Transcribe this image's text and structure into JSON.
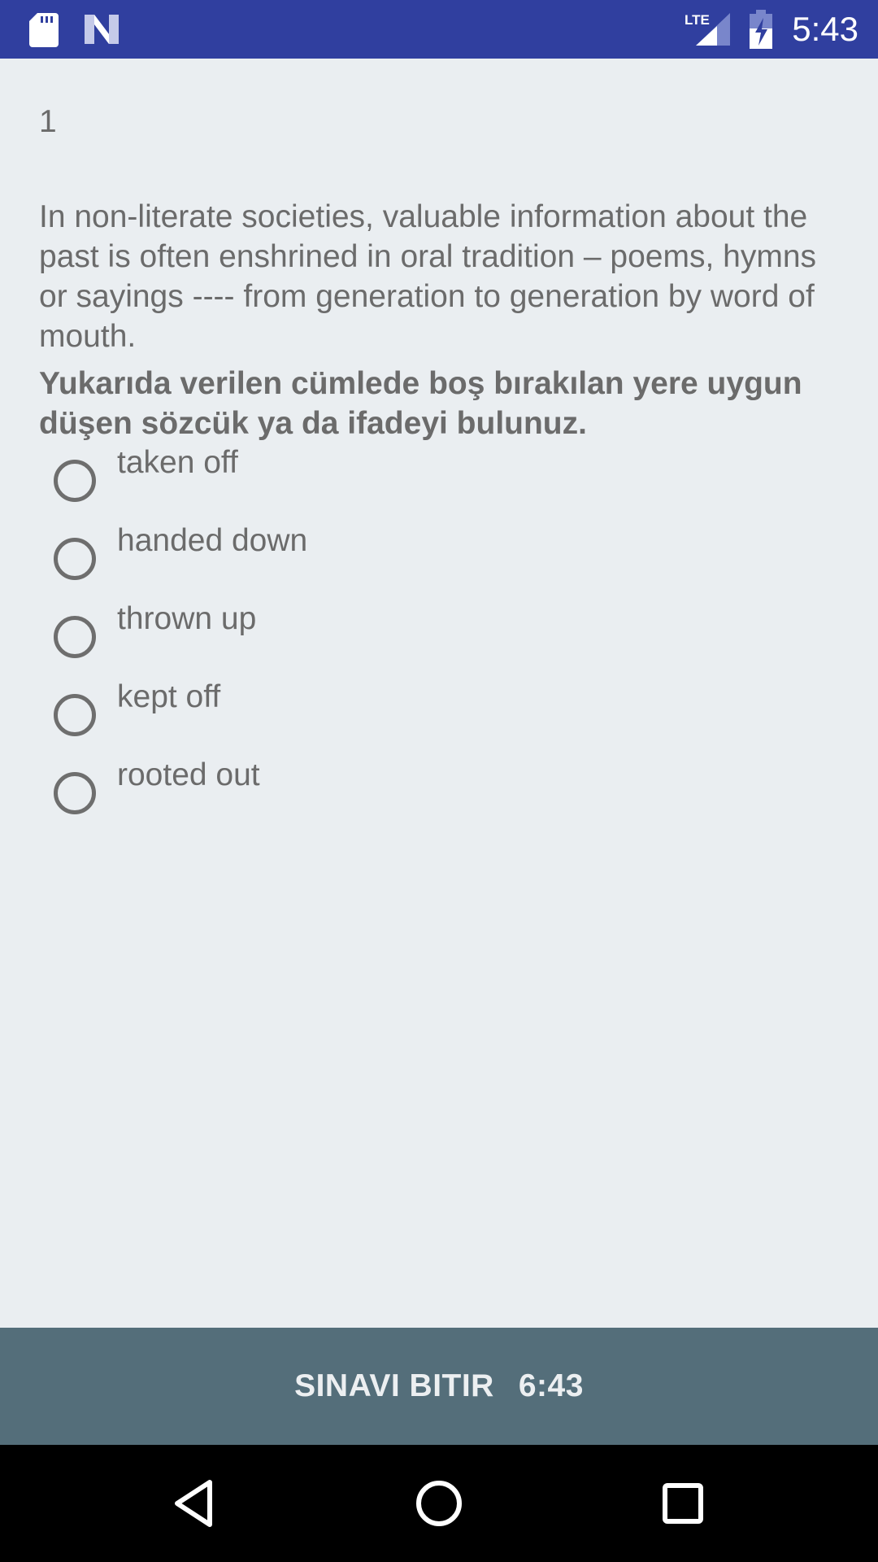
{
  "status_bar": {
    "time": "5:43",
    "icons": [
      "sd-card-icon",
      "n-logo-icon",
      "lte-signal-icon",
      "battery-charging-icon"
    ],
    "background": "#303f9f"
  },
  "question": {
    "number": "1",
    "text": "In non-literate societies, valuable information about the past is often enshrined in oral tradition – poems, hymns or sayings ---- from generation to generation by word of mouth.",
    "instruction": "Yukarıda verilen cümlede boş bırakılan yere uygun düşen sözcük ya da ifadeyi bulunuz."
  },
  "options": [
    {
      "label": "taken off",
      "selected": false
    },
    {
      "label": "handed down",
      "selected": false
    },
    {
      "label": "thrown up",
      "selected": false
    },
    {
      "label": "kept off",
      "selected": false
    },
    {
      "label": "rooted out",
      "selected": false
    }
  ],
  "finish_bar": {
    "label": "SINAVI BITIR",
    "timer": "6:43",
    "background": "#546e7a"
  },
  "nav_bar": {
    "buttons": [
      "back-icon",
      "home-icon",
      "recents-icon"
    ]
  }
}
